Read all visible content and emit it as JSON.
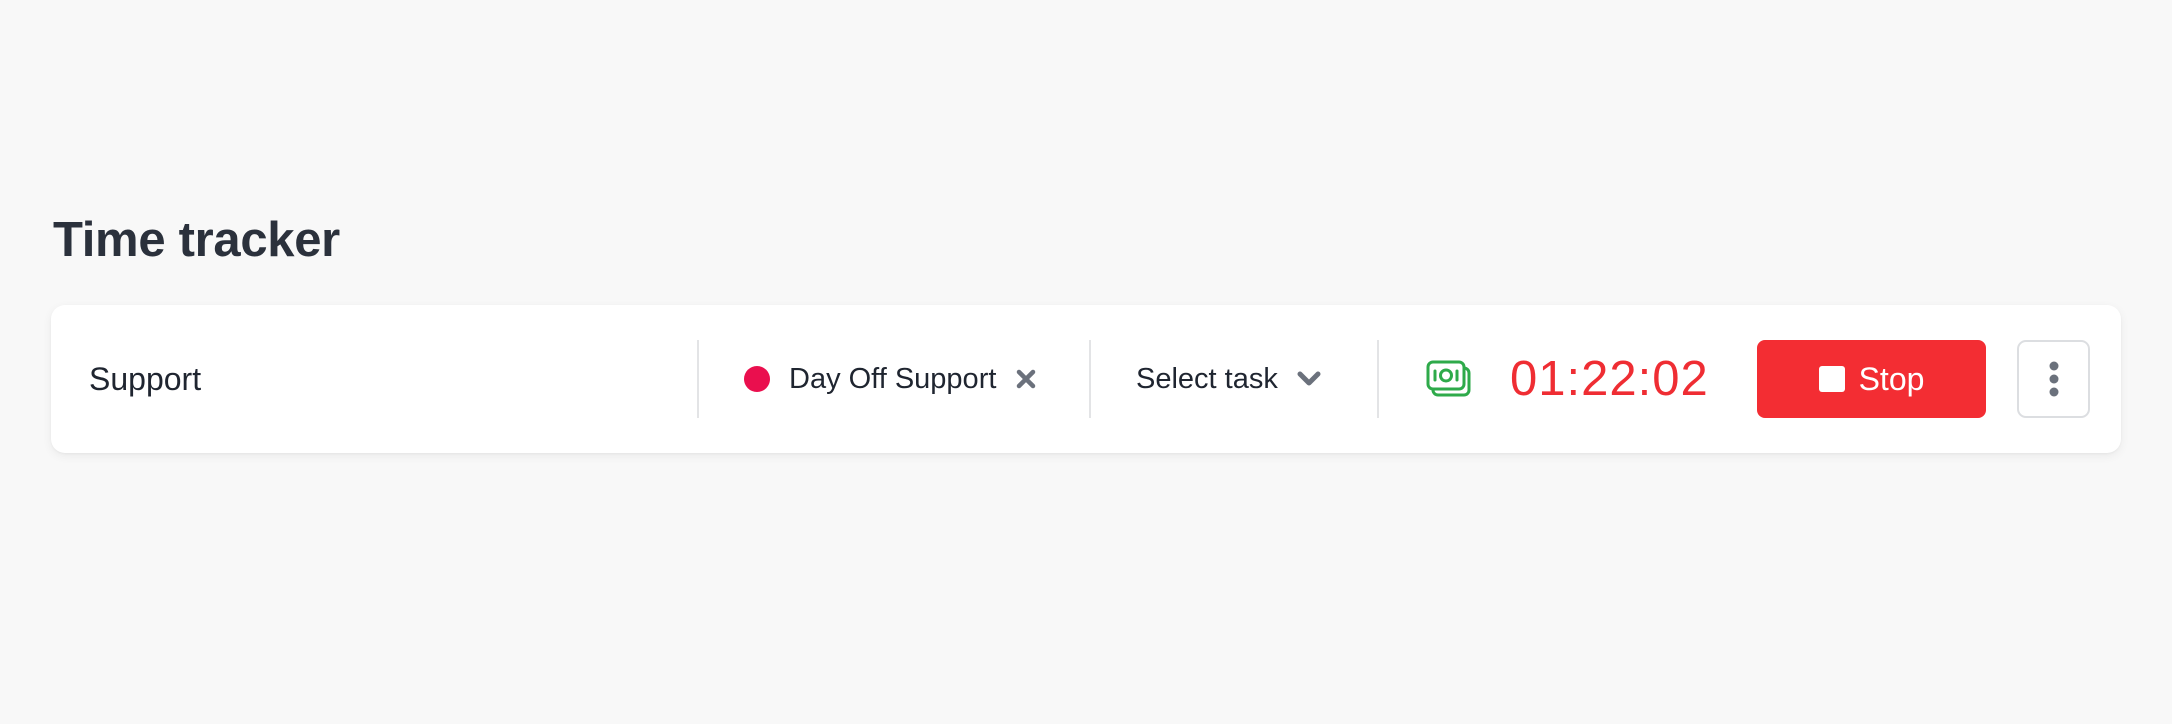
{
  "page": {
    "title": "Time tracker"
  },
  "tracker": {
    "description": "Support",
    "project": {
      "name": "Day Off Support",
      "color": "#ea0f4e",
      "clear_icon": "close-icon"
    },
    "task": {
      "label": "Select task",
      "icon": "chevron-down-icon"
    },
    "billable": {
      "icon": "money-icon",
      "color": "#2eaa4a"
    },
    "timer": "01:22:02",
    "stop_button": {
      "label": "Stop",
      "color": "#f32d33"
    },
    "more_icon": "vertical-dots-icon"
  }
}
